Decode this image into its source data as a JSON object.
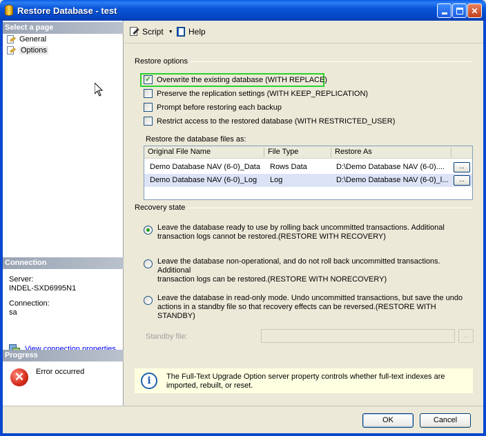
{
  "window": {
    "title": "Restore Database - test"
  },
  "left": {
    "select_page_header": "Select a page",
    "pages": [
      {
        "label": "General"
      },
      {
        "label": "Options"
      }
    ],
    "connection_header": "Connection",
    "server_label": "Server:",
    "server_value": "INDEL-SXD6995N1",
    "connection_label": "Connection:",
    "connection_value": "sa",
    "view_props_link": "View connection properties",
    "progress_header": "Progress",
    "progress_status": "Error occurred"
  },
  "toolbar": {
    "script_label": "Script",
    "help_label": "Help"
  },
  "restore_options": {
    "title": "Restore options",
    "options": [
      {
        "label": "Overwrite the existing database (WITH REPLACE)",
        "checked": true
      },
      {
        "label": "Preserve the replication settings (WITH KEEP_REPLICATION)",
        "checked": false
      },
      {
        "label": "Prompt before restoring each backup",
        "checked": false
      },
      {
        "label": "Restrict access to the restored database (WITH RESTRICTED_USER)",
        "checked": false
      }
    ],
    "files_label": "Restore the database files as:"
  },
  "files_grid": {
    "columns": [
      "Original File Name",
      "File Type",
      "Restore As"
    ],
    "rows": [
      {
        "original": "Demo Database NAV (6-0)_Data",
        "type": "Rows Data",
        "restore_as": "D:\\Demo Database NAV (6-0)....",
        "button": "..."
      },
      {
        "original": "Demo Database NAV (6-0)_Log",
        "type": "Log",
        "restore_as": "D:\\Demo Database NAV (6-0)_l...",
        "button": "..."
      }
    ]
  },
  "recovery": {
    "title": "Recovery state",
    "options": [
      {
        "line1": "Leave the database ready to use by rolling back uncommitted transactions. Additional",
        "line2": "transaction logs cannot be restored.(RESTORE WITH RECOVERY)",
        "selected": true
      },
      {
        "line1": "Leave the database non-operational, and do not roll back uncommitted transactions. Additional",
        "line2": "transaction logs can be restored.(RESTORE WITH NORECOVERY)",
        "selected": false
      },
      {
        "line1": "Leave the database in read-only mode. Undo uncommitted transactions, but save the undo",
        "line2": "actions in a standby file so that recovery effects can be reversed.(RESTORE WITH STANDBY)",
        "selected": false
      }
    ],
    "standby_label": "Standby file:",
    "standby_value": "",
    "standby_button": "..."
  },
  "info": {
    "text": "The Full-Text Upgrade Option server property controls whether full-text indexes are imported, rebuilt, or reset."
  },
  "footer": {
    "ok_label": "OK",
    "cancel_label": "Cancel"
  },
  "colors": {
    "highlight": "#2bd12b",
    "title_bar": "#0a56d8",
    "link": "#0000ff",
    "error": "#d42a1a"
  }
}
